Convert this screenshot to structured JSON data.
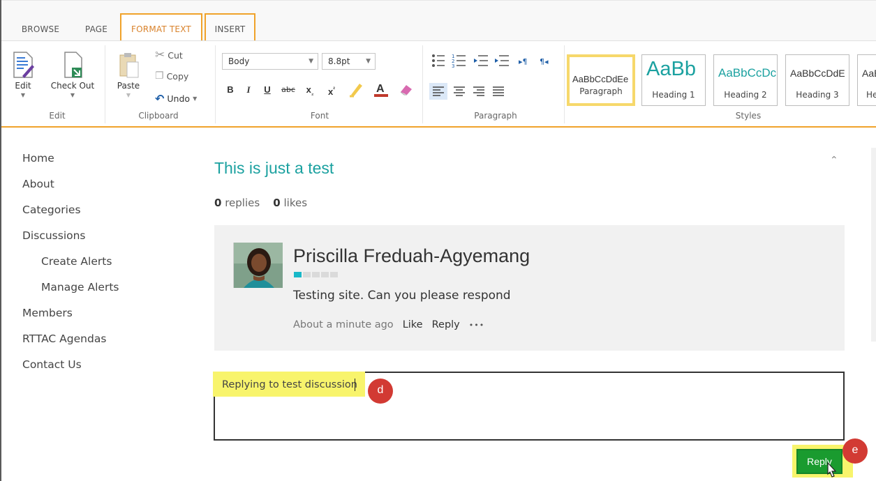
{
  "ribbon": {
    "tabs": [
      {
        "label": "BROWSE"
      },
      {
        "label": "PAGE"
      },
      {
        "label": "FORMAT TEXT"
      },
      {
        "label": "INSERT"
      }
    ],
    "edit_group": {
      "edit": "Edit",
      "check_out": "Check Out",
      "label": "Edit"
    },
    "clipboard_group": {
      "paste": "Paste",
      "cut": "Cut",
      "copy": "Copy",
      "undo": "Undo",
      "label": "Clipboard"
    },
    "font_group": {
      "style_value": "Body",
      "size_value": "8.8pt",
      "bold": "B",
      "italic": "I",
      "underline": "U",
      "strike": "abc",
      "label": "Font"
    },
    "paragraph_group": {
      "label": "Paragraph"
    },
    "styles_group": {
      "label": "Styles",
      "cards": [
        {
          "sample": "AaBbCcDdEe",
          "name": "Paragraph"
        },
        {
          "sample": "AaBb",
          "name": "Heading 1"
        },
        {
          "sample": "AaBbCcDc",
          "name": "Heading 2"
        },
        {
          "sample": "AaBbCcDdE",
          "name": "Heading 3"
        },
        {
          "sample": "AaBb",
          "name": "He"
        }
      ]
    }
  },
  "nav": {
    "items": [
      {
        "label": "Home"
      },
      {
        "label": "About"
      },
      {
        "label": "Categories"
      },
      {
        "label": "Discussions"
      },
      {
        "label": "Create Alerts"
      },
      {
        "label": "Manage Alerts"
      },
      {
        "label": "Members"
      },
      {
        "label": "RTTAC Agendas"
      },
      {
        "label": "Contact Us"
      }
    ]
  },
  "discussion": {
    "title": "This is just a test",
    "replies_count": "0",
    "replies_label": "replies",
    "likes_count": "0",
    "likes_label": "likes"
  },
  "post": {
    "author": "Priscilla Freduah-Agyemang",
    "body": "Testing site. Can you please respond",
    "timestamp": "About a minute ago",
    "like_label": "Like",
    "reply_label": "Reply",
    "more_label": "•••"
  },
  "reply_box": {
    "value": "Replying to test discussion"
  },
  "reply_button": {
    "label": "Reply"
  },
  "badges": {
    "d": "d",
    "e": "e"
  },
  "colors": {
    "accent": "#f0a22a",
    "title": "#1ba1a0",
    "reply_button": "#1a9b2f",
    "highlight": "#f8f46c",
    "badge": "#d23a33"
  }
}
